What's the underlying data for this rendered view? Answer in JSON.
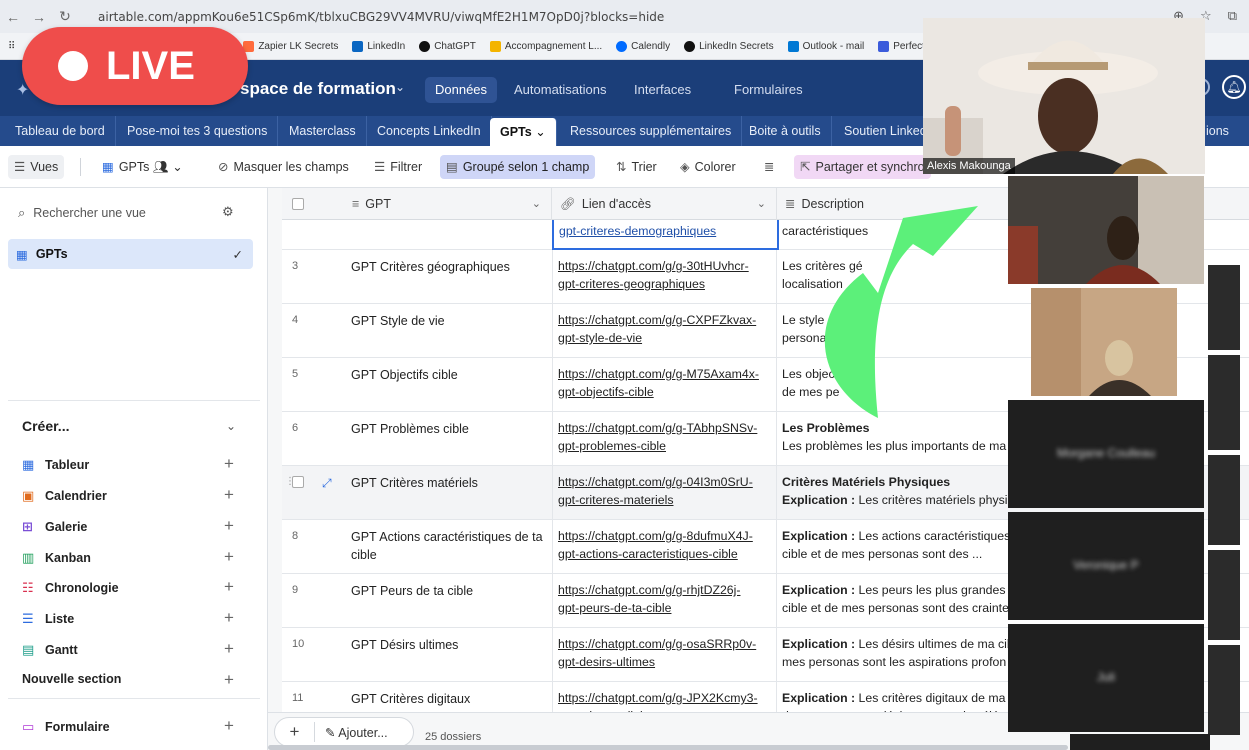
{
  "browser": {
    "url": "airtable.com/appmKou6e51CSp6mK/tblxuCBG29VV4MVRU/viwqMfE2H1M7OpD0j?blocks=hide",
    "bookmarks": [
      {
        "label": "Zapier LK Secrets",
        "color": "#ff6b3d"
      },
      {
        "label": "LinkedIn",
        "color": "#0a66c2"
      },
      {
        "label": "ChatGPT",
        "color": "#111111"
      },
      {
        "label": "Accompagnement L...",
        "color": "#f4b400"
      },
      {
        "label": "Calendly",
        "color": "#006bff"
      },
      {
        "label": "LinkedIn Secrets",
        "color": "#111111"
      },
      {
        "label": "Outlook - mail",
        "color": "#0078d4"
      },
      {
        "label": "PerfectPost | Tablea...",
        "color": "#3b5bdb"
      }
    ]
  },
  "live_badge": {
    "label": "LIVE"
  },
  "header": {
    "base_title": "space de formation",
    "nav": [
      "Données",
      "Automatisations",
      "Interfaces",
      "Formulaires"
    ],
    "active_nav": "Données"
  },
  "tables": {
    "tabs": [
      "Tableau de bord",
      "Pose-moi tes 3 questions",
      "Masterclass",
      "Concepts LinkedIn",
      "GPTs",
      "Ressources supplémentaires",
      "Boite à outils",
      "Soutien Linked"
    ],
    "active": "GPTs",
    "partial_tab": "ions"
  },
  "toolbar": {
    "views_label": "Vues",
    "view_name": "GPTs",
    "hide_fields": "Masquer les champs",
    "filter": "Filtrer",
    "group": "Groupé selon 1 champ",
    "sort": "Trier",
    "color": "Colorer",
    "share": "Partager et synchro"
  },
  "sidebar": {
    "search_placeholder": "Rechercher une vue",
    "active_view": "GPTs",
    "create_label": "Créer...",
    "create_items": [
      "Tableur",
      "Calendrier",
      "Galerie",
      "Kanban",
      "Chronologie",
      "Liste",
      "Gantt"
    ],
    "new_section": "Nouvelle section",
    "form_item": "Formulaire"
  },
  "grid": {
    "columns": [
      "GPT",
      "Lien d'accès",
      "Description"
    ],
    "first_row": {
      "link": "gpt-criteres-demographiques",
      "desc": "caractéristiques"
    },
    "rows": [
      {
        "num": "3",
        "name": "GPT Critères géographiques",
        "link1": "https://chatgpt.com/g/g-30tHUvhcr-",
        "link2": "gpt-criteres-geographiques",
        "d1_b": "",
        "d1": "Les critères gé",
        "d2": "localisation"
      },
      {
        "num": "4",
        "name": "GPT Style de vie",
        "link1": "https://chatgpt.com/g/g-CXPFZkvax-",
        "link2": "gpt-style-de-vie",
        "d1_b": "",
        "d1": "Le style",
        "d2": "personas"
      },
      {
        "num": "5",
        "name": "GPT Objectifs cible",
        "link1": "https://chatgpt.com/g/g-M75Axam4x-",
        "link2": "gpt-objectifs-cible",
        "d1_b": "",
        "d1": "Les objec",
        "d2": "de mes pe"
      },
      {
        "num": "6",
        "name": "GPT Problèmes cible",
        "link1": "https://chatgpt.com/g/g-TAbhpSNSv-",
        "link2": "gpt-problemes-cible",
        "d1_b": "Les Problèmes",
        "d1": "",
        "d2": "Les problèmes les plus importants de ma"
      },
      {
        "num": "7",
        "name": "GPT Critères matériels",
        "link1": "https://chatgpt.com/g/g-04I3m0SrU-",
        "link2": "gpt-criteres-materiels",
        "d1_b": "Critères Matériels Physiques",
        "d1": "",
        "d2_b": "Explication :",
        "d2": " Les critères matériels physiq"
      },
      {
        "num": "8",
        "name": "GPT Actions caractéristiques de ta cible",
        "link1": "https://chatgpt.com/g/g-8dufmuX4J-",
        "link2": "gpt-actions-caracteristiques-cible",
        "d1_b": "Explication :",
        "d1": " Les actions caractéristiques",
        "d2": "cible et de mes personas sont des ..."
      },
      {
        "num": "9",
        "name": "GPT Peurs de ta cible",
        "link1": "https://chatgpt.com/g/g-rhjtDZ26j-",
        "link2": "gpt-peurs-de-ta-cible",
        "d1_b": "Explication :",
        "d1": " Les peurs les plus grandes d",
        "d2": "cible et de mes personas sont des crainte"
      },
      {
        "num": "10",
        "name": "GPT Désirs ultimes",
        "link1": "https://chatgpt.com/g/g-osaSRRp0v-",
        "link2": "gpt-desirs-ultimes",
        "d1_b": "Explication :",
        "d1": " Les désirs ultimes de ma cib",
        "d2": "mes personas sont les aspirations profon"
      },
      {
        "num": "11",
        "name": "GPT Critères digitaux",
        "link1": "https://chatgpt.com/g/g-JPX2Kcmy3-",
        "link2": "gpt-criteres-digitaux",
        "d1_b": "Explication :",
        "d1": " Les critères digitaux de ma",
        "d2": "de mes personas désignent tous les élém"
      }
    ],
    "add_label": "Ajouter...",
    "record_count": "25 dossiers"
  },
  "video": {
    "host_name": "Alexis Makounga",
    "participants": [
      "Morgane Coulleau",
      "Veronique P",
      "Juli"
    ]
  },
  "colors": {
    "header_bg": "#1b3e79",
    "tab_bg": "#254b8c",
    "live_red": "#ef4d4b",
    "arrow_green": "#5cf07a",
    "link_blue": "#1f4fa8"
  }
}
